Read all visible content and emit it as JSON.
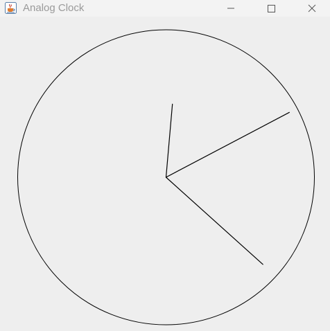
{
  "window": {
    "title": "Analog Clock",
    "app_icon": "java-cup-icon",
    "controls": [
      {
        "name": "minimize-button",
        "icon": "minimize-icon"
      },
      {
        "name": "maximize-button",
        "icon": "maximize-icon"
      },
      {
        "name": "close-button",
        "icon": "close-icon"
      }
    ]
  },
  "clock": {
    "face_color": "#eeeeee",
    "line_color": "#000000",
    "time": {
      "hour": 0,
      "minute": 10,
      "second": 22
    }
  }
}
